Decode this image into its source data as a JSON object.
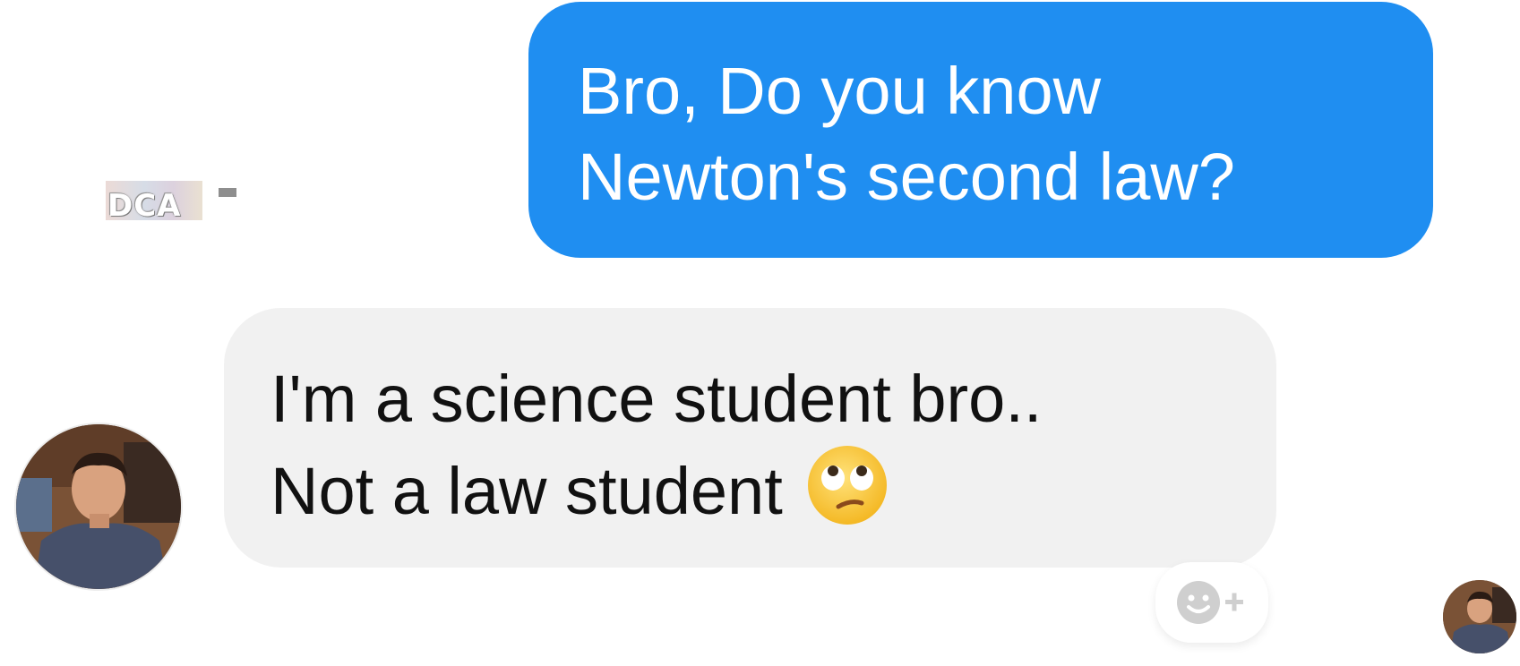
{
  "conversation": {
    "sent_message": {
      "lines": [
        "Bro, Do you know",
        "Newton's second law?"
      ],
      "bubble_color": "#1f8ef1",
      "text_color": "#ffffff"
    },
    "received_message": {
      "lines": [
        "I'm a science student bro..",
        "Not a law student"
      ],
      "emoji": "eye-roll-emoji",
      "bubble_color": "#f1f1f1",
      "text_color": "#111111"
    },
    "watermark": {
      "text": "DCA"
    },
    "avatars": {
      "sender_avatar": "contact-avatar-photo",
      "read_receipt_avatar": "read-receipt-avatar-photo"
    },
    "reaction_button": {
      "icon": "add-reaction-icon"
    }
  }
}
